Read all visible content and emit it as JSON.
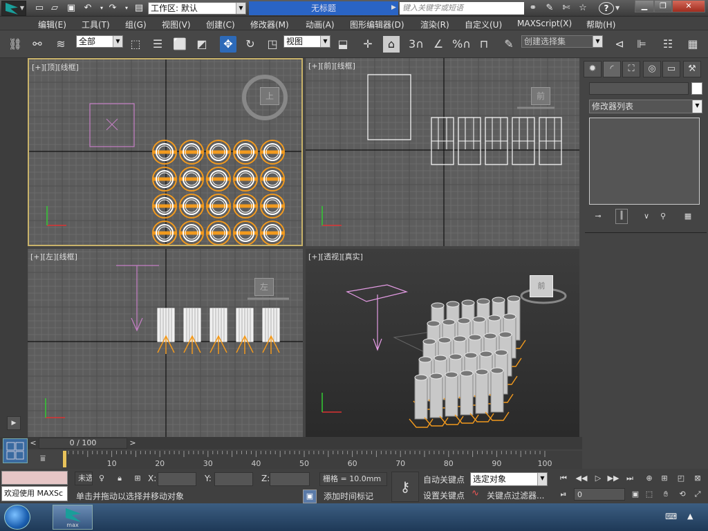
{
  "titlebar": {
    "workspace_label": "工作区: 默认",
    "document_title": "无标题",
    "search_placeholder": "键入关键字或短语",
    "help_icon": "?"
  },
  "menu": {
    "items": [
      "编辑(E)",
      "工具(T)",
      "组(G)",
      "视图(V)",
      "创建(C)",
      "修改器(M)",
      "动画(A)",
      "图形编辑器(D)",
      "渲染(R)",
      "自定义(U)",
      "MAXScript(X)",
      "帮助(H)"
    ]
  },
  "toolbar": {
    "selection_filter": "全部",
    "reference_coord": "视图",
    "named_selection_placeholder": "创建选择集",
    "snap_label": "3",
    "percent_label": "%"
  },
  "viewports": {
    "top": {
      "label": "[+][顶][线框]",
      "cube_label": "上"
    },
    "front": {
      "label": "[+][前][线框]",
      "cube_label": "前"
    },
    "left": {
      "label": "[+][左][线框]",
      "cube_label": "左"
    },
    "perspective": {
      "label": "[+][透视][真实]",
      "cube_label": "前"
    }
  },
  "command_panel": {
    "modifier_list": "修改器列表"
  },
  "timeline": {
    "frame_display": "0 / 100",
    "ruler_ticks": [
      "10",
      "20",
      "30",
      "40",
      "50",
      "60",
      "70",
      "80",
      "90",
      "100"
    ]
  },
  "status": {
    "maxscript_welcome": "欢迎使用 MAXSc",
    "selection_status": "未选",
    "x_label": "X:",
    "y_label": "Y:",
    "z_label": "Z:",
    "grid_label": "栅格 = 10.0mm",
    "prompt": "单击并拖动以选择并移动对象",
    "add_time_tag": "添加时间标记",
    "auto_key": "自动关键点",
    "set_key": "设置关键点",
    "key_mode": "选定对象",
    "key_filters": "关键点过滤器...",
    "current_frame": "0"
  },
  "taskbar": {
    "app_label": "max"
  }
}
